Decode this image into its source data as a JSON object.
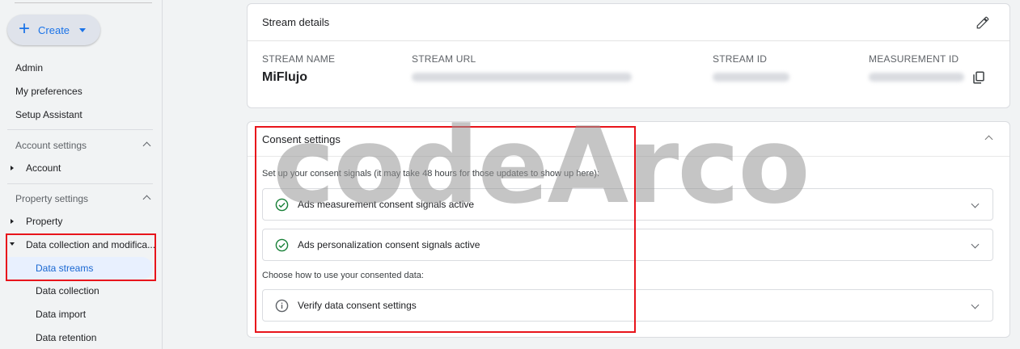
{
  "sidebar": {
    "create_label": "Create",
    "items": {
      "admin": "Admin",
      "my_preferences": "My preferences",
      "setup_assistant": "Setup Assistant"
    },
    "account_settings": {
      "title": "Account settings",
      "account": "Account"
    },
    "property_settings": {
      "title": "Property settings",
      "property": "Property",
      "data_collection_group": "Data collection and modifica...",
      "sub": {
        "data_streams": "Data streams",
        "data_collection": "Data collection",
        "data_import": "Data import",
        "data_retention": "Data retention"
      }
    }
  },
  "stream_details": {
    "title": "Stream details",
    "columns": {
      "stream_name_label": "STREAM NAME",
      "stream_name_value": "MiFlujo",
      "stream_url_label": "STREAM URL",
      "stream_id_label": "STREAM ID",
      "measurement_id_label": "MEASUREMENT ID"
    }
  },
  "consent_settings": {
    "title": "Consent settings",
    "intro": "Set up your consent signals (it may take 48 hours for those updates to show up here):",
    "signals": [
      "Ads measurement consent signals active",
      "Ads personalization consent signals active"
    ],
    "choose_label": "Choose how to use your consented data:",
    "verify_label": "Verify data consent settings"
  },
  "watermark": "codeArco",
  "colors": {
    "accent": "#1a73e8",
    "highlight_box": "#e8141b",
    "check_green": "#188038"
  }
}
